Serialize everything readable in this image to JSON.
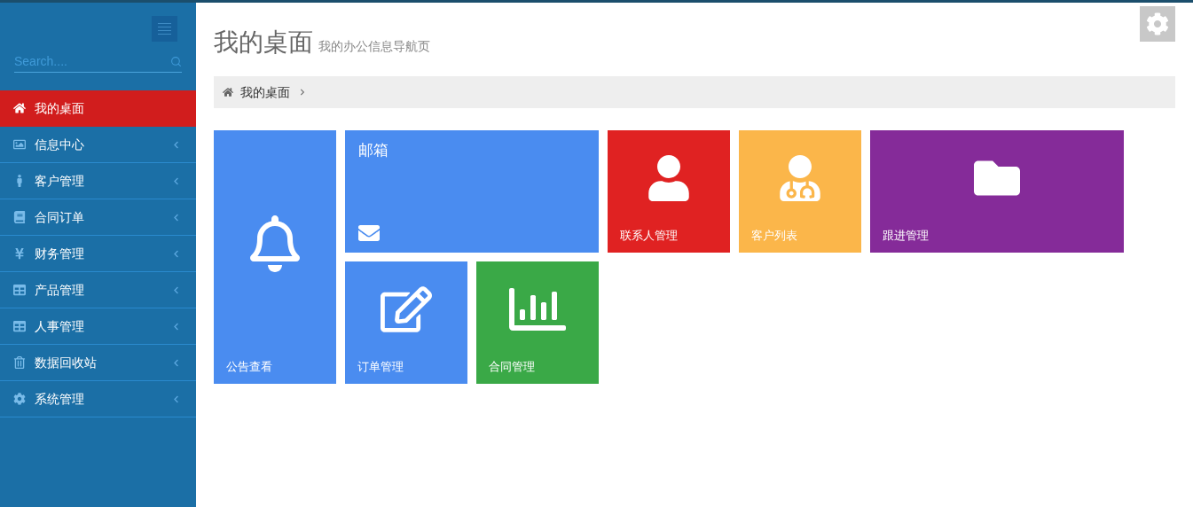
{
  "sidebar": {
    "search": {
      "placeholder": "Search...."
    },
    "items": [
      {
        "label": "我的桌面",
        "selected": true,
        "expandable": false
      },
      {
        "label": "信息中心",
        "selected": false,
        "expandable": true
      },
      {
        "label": "客户管理",
        "selected": false,
        "expandable": true
      },
      {
        "label": "合同订单",
        "selected": false,
        "expandable": true
      },
      {
        "label": "财务管理",
        "selected": false,
        "expandable": true
      },
      {
        "label": "产品管理",
        "selected": false,
        "expandable": true
      },
      {
        "label": "人事管理",
        "selected": false,
        "expandable": true
      },
      {
        "label": "数据回收站",
        "selected": false,
        "expandable": true
      },
      {
        "label": "系统管理",
        "selected": false,
        "expandable": true
      }
    ]
  },
  "page": {
    "title": "我的桌面",
    "subtitle": "我的办公信息导航页"
  },
  "breadcrumb": [
    "我的桌面"
  ],
  "tiles": [
    {
      "label": "公告查看",
      "kind": "tall",
      "color": "#4a8cf0"
    },
    {
      "label": "邮箱",
      "kind": "mail",
      "color": "#4a8cf0"
    },
    {
      "label": "联系人管理",
      "kind": "small",
      "color": "#e02222"
    },
    {
      "label": "客户列表",
      "kind": "small",
      "color": "#fbb64a"
    },
    {
      "label": "跟进管理",
      "kind": "wide",
      "color": "#852b99"
    },
    {
      "label": "订单管理",
      "kind": "small",
      "color": "#4a8cf0"
    },
    {
      "label": "合同管理",
      "kind": "small",
      "color": "#3aa947"
    }
  ]
}
